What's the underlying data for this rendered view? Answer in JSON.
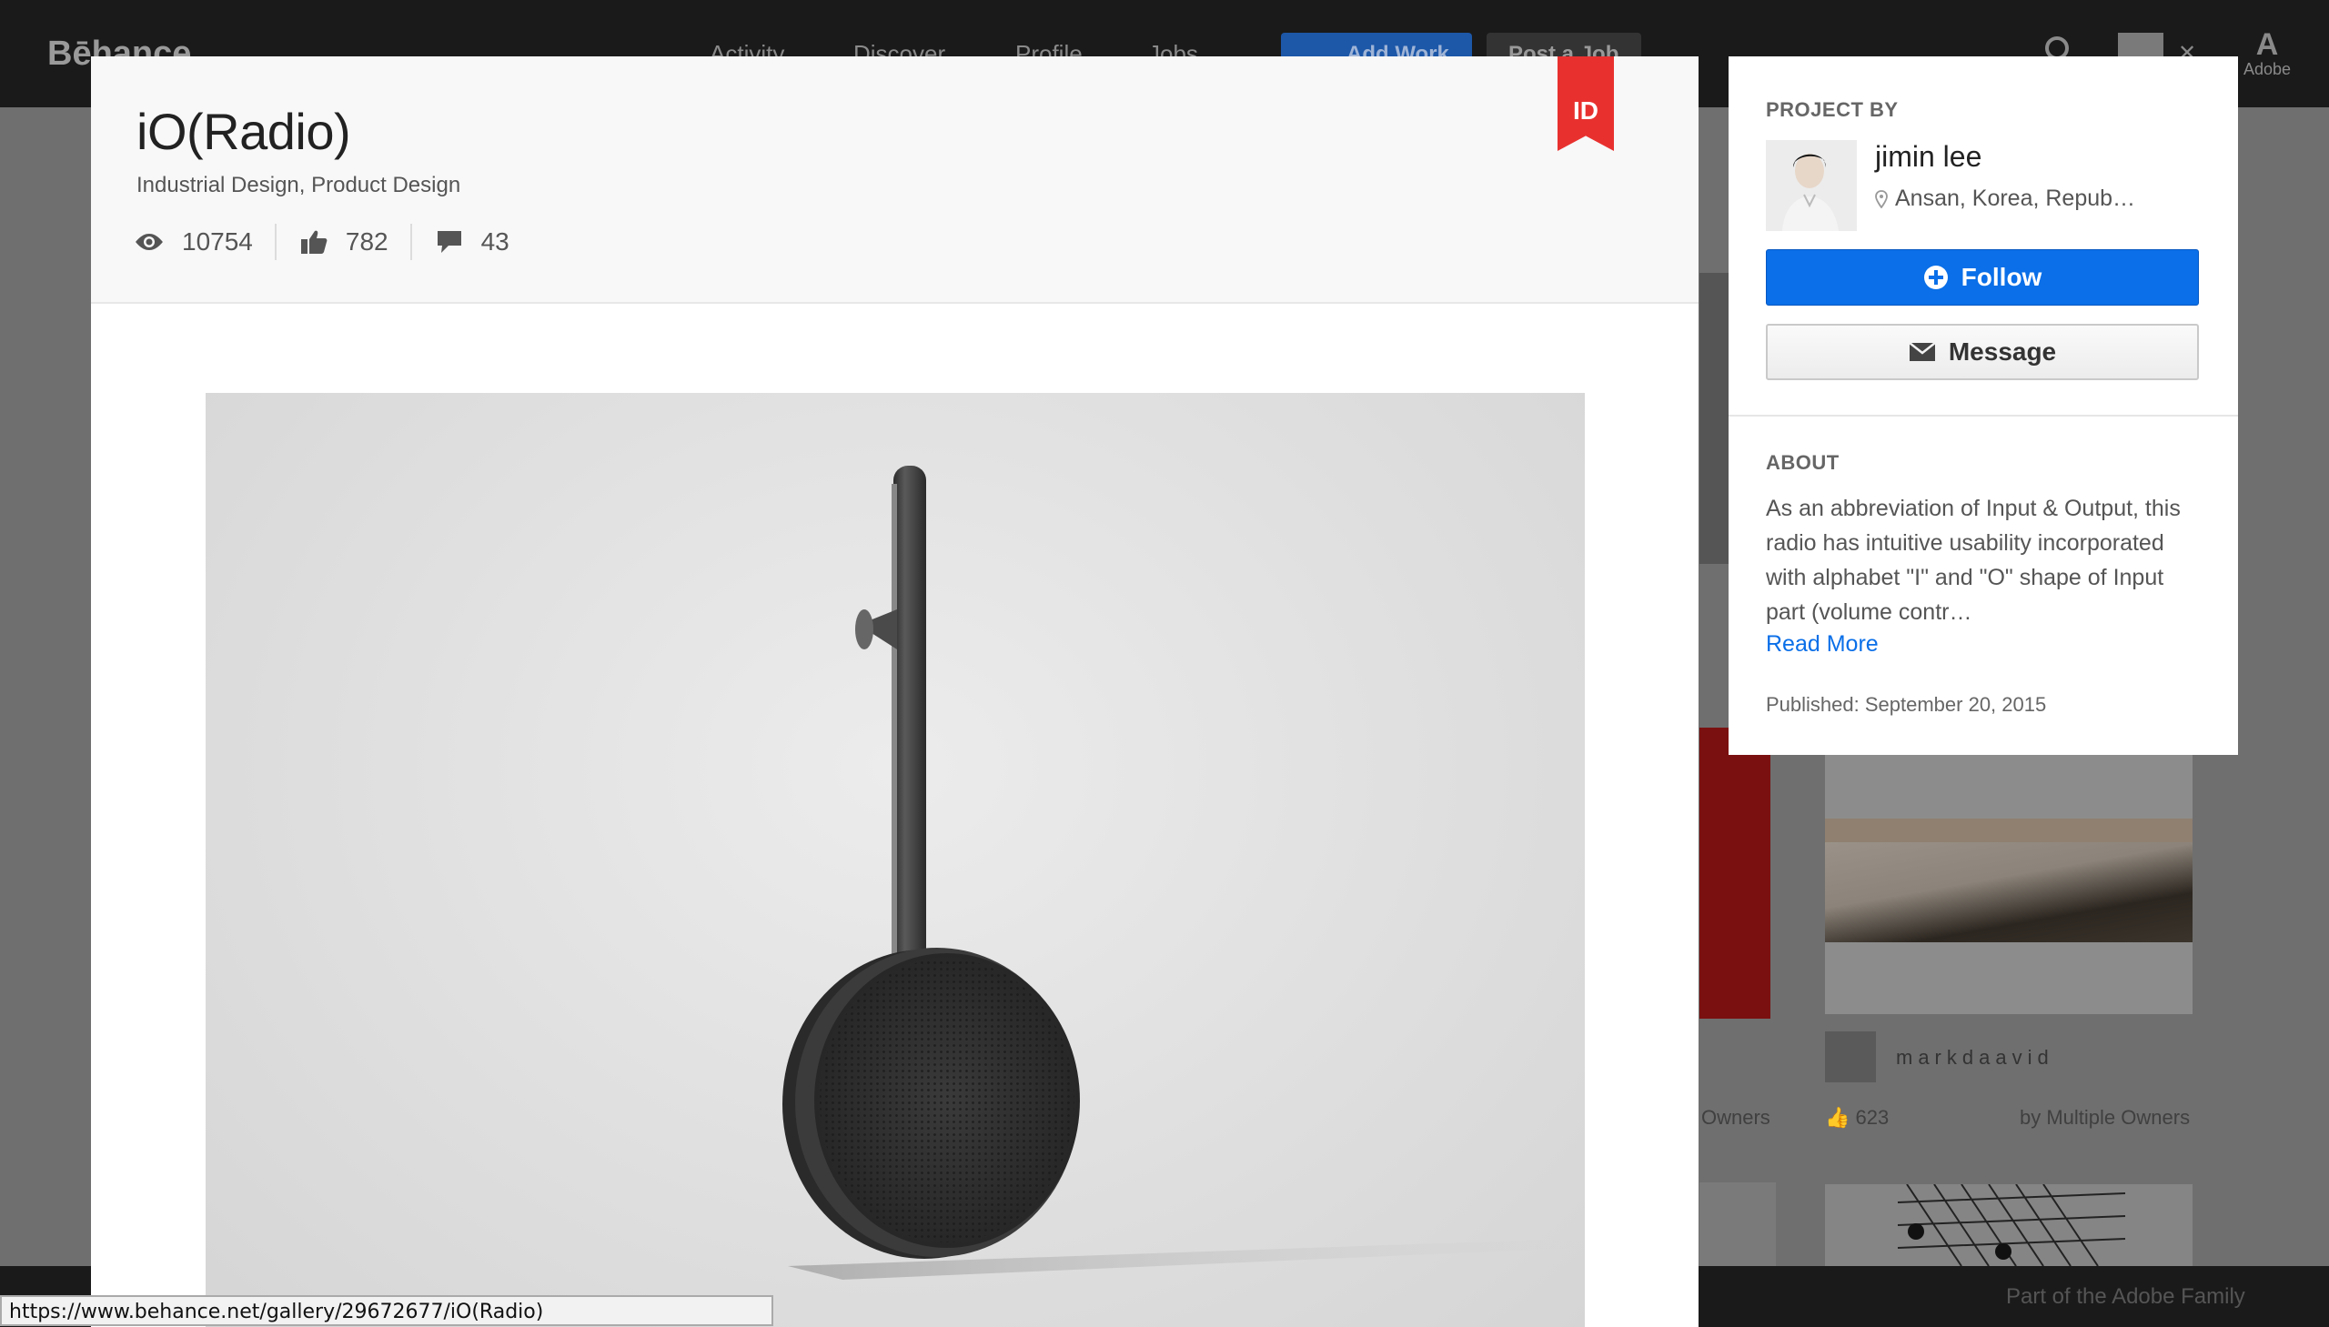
{
  "topbar": {
    "logo": "Bēhance",
    "nav": [
      "Activity",
      "Discover",
      "Profile",
      "Jobs"
    ],
    "add_work": "Add Work",
    "post_job": "Post a Job",
    "adobe": "Adobe"
  },
  "background": {
    "cards": [
      {
        "owner": "markdaavid",
        "likes": "623",
        "owners": "by Multiple Owners"
      },
      {
        "owners_partial": "Owners"
      }
    ],
    "footer": "Part of the Adobe Family"
  },
  "project": {
    "title": "iO(Radio)",
    "fields": "Industrial Design, Product Design",
    "views": "10754",
    "appreciations": "782",
    "comments": "43",
    "ribbon": "ID"
  },
  "side": {
    "project_by_label": "PROJECT BY",
    "owner_name": "jimin lee",
    "owner_location": "Ansan, Korea, Repub…",
    "follow_label": "Follow",
    "message_label": "Message",
    "about_label": "ABOUT",
    "about_text": "As an abbreviation of Input & Output, this radio has intuitive usability incorporated with alphabet \"I\" and \"O\" shape of Input part (volume contr…",
    "read_more": "Read More",
    "published": "Published: September 20, 2015"
  },
  "status_bar": {
    "url": "https://www.behance.net/gallery/29672677/iO(Radio)"
  },
  "colors": {
    "accent_blue": "#0a6fe8",
    "ribbon_red": "#e8312f"
  }
}
